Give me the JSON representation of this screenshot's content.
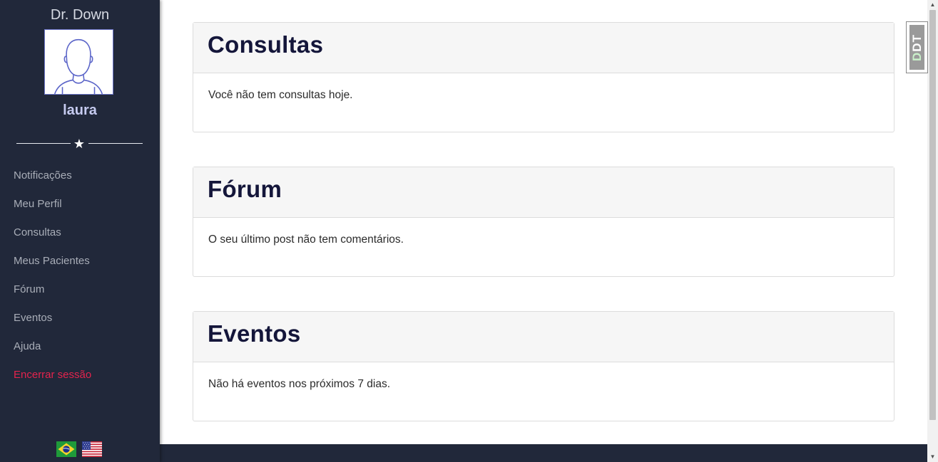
{
  "brand": "Dr. Down",
  "user": {
    "name": "laura"
  },
  "nav": {
    "items": [
      {
        "label": "Notificações"
      },
      {
        "label": "Meu Perfil"
      },
      {
        "label": "Consultas"
      },
      {
        "label": "Meus Pacientes"
      },
      {
        "label": "Fórum"
      },
      {
        "label": "Eventos"
      },
      {
        "label": "Ajuda"
      },
      {
        "label": "Encerrar sessão"
      }
    ]
  },
  "languages": [
    "pt-BR",
    "en-US"
  ],
  "cards": [
    {
      "title": "Consultas",
      "body": "Você não tem consultas hoje."
    },
    {
      "title": "Fórum",
      "body": "O seu último post não tem comentários."
    },
    {
      "title": "Eventos",
      "body": "Não há eventos nos próximos 7 dias."
    }
  ],
  "badge": {
    "text": "DDT",
    "prefix": "D",
    "suffix": "DT"
  },
  "colors": {
    "sidebar_bg": "#21283a",
    "logout": "#e4234d",
    "title": "#14163a",
    "username": "#c6cbf0"
  }
}
